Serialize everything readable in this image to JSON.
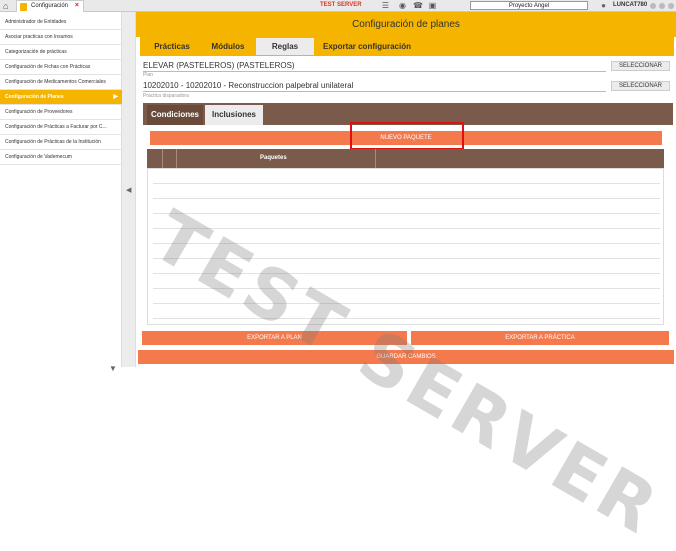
{
  "topbar": {
    "app_tab": "Configuración",
    "close": "×",
    "server_label": "TEST SERVER",
    "project": "Proyecto Angel",
    "user": "LUNCAT780"
  },
  "sidebar": {
    "items": [
      {
        "label": "Administrador de Entidades"
      },
      {
        "label": "Asociar practicas con Insumos"
      },
      {
        "label": "Categorización de prácticas"
      },
      {
        "label": "Configuración de Fichas con Prácticas"
      },
      {
        "label": "Configuración de Medicamentos Comerciales"
      },
      {
        "label": "Configuración de Planes",
        "active": true
      },
      {
        "label": "Configuración de Proveedores"
      },
      {
        "label": "Configuración de Prácticas a Facturar por C..."
      },
      {
        "label": "Configuración de Prácticas de la Institución"
      },
      {
        "label": "Configuración de Vademecum"
      }
    ]
  },
  "header": {
    "title": "Configuración de planes"
  },
  "tabs": [
    {
      "label": "Prácticas"
    },
    {
      "label": "Módulos"
    },
    {
      "label": "Reglas",
      "active": true
    },
    {
      "label": "Exportar configuración"
    }
  ],
  "form": {
    "plan_value": "ELEVAR (PASTELEROS) (PASTELEROS)",
    "plan_label": "Plan",
    "practica_value": "10202010 - 10202010 - Reconstruccion palpebral unilateral",
    "practica_label": "Práctica disparadora",
    "select_label": "SELECCIONAR"
  },
  "subtabs": [
    {
      "label": "Condiciones",
      "active": true
    },
    {
      "label": "Inclusiones"
    }
  ],
  "buttons": {
    "nuevo_paquete": "NUEVO PAQUETE",
    "exportar_plan": "EXPORTAR A PLAN",
    "exportar_practica": "EXPORTAR A PRÁCTICA",
    "guardar": "GUARDAR CAMBIOS"
  },
  "grid": {
    "header": "Paquetes"
  },
  "watermark": "TEST SERVER",
  "colors": {
    "accent": "#f5b400",
    "brown": "#7a5a4a",
    "orange_button": "#f47a4d",
    "server_red": "#d32222"
  }
}
